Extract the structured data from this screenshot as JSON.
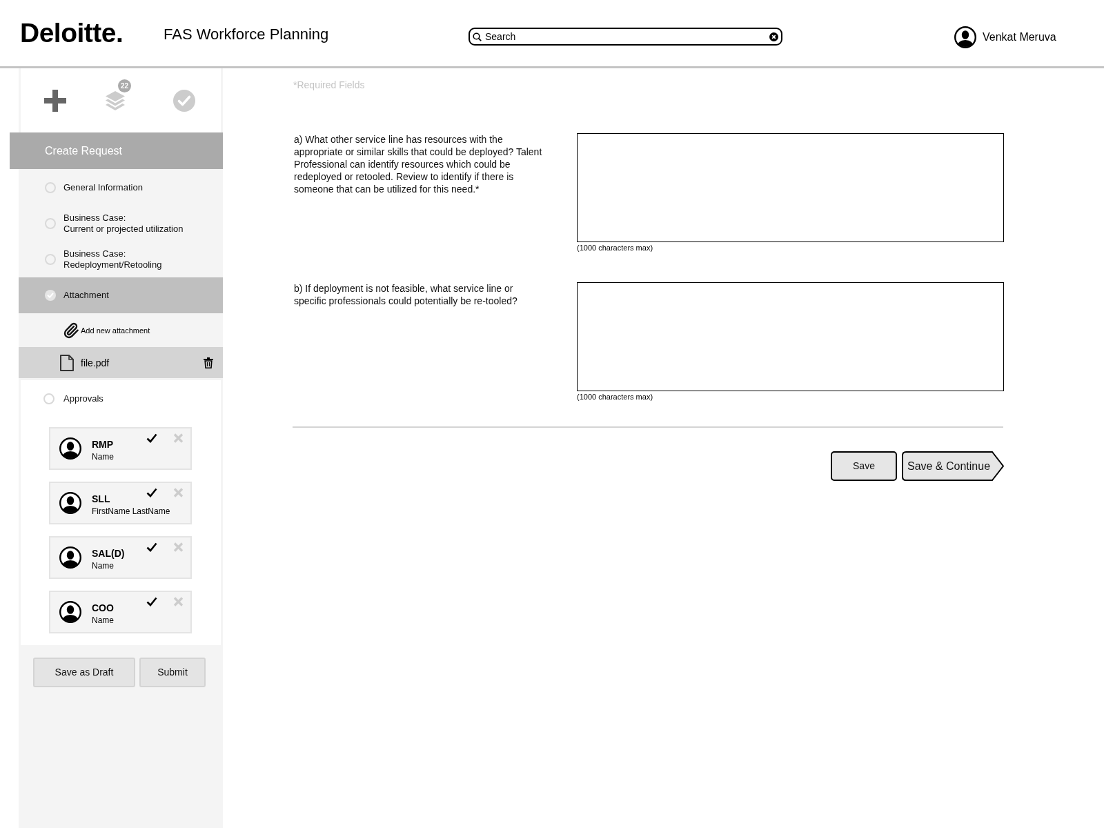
{
  "header": {
    "logo": "Deloitte.",
    "title": "FAS Workforce Planning",
    "search": {
      "placeholder": "Search"
    },
    "user": {
      "name": "Venkat Meruva"
    }
  },
  "sidebar": {
    "toolbar": [
      {
        "kind": "add",
        "active": true
      },
      {
        "kind": "layers",
        "active": false,
        "badge": "22"
      },
      {
        "kind": "done",
        "active": false
      }
    ],
    "section_title": "Create Request",
    "steps": [
      {
        "label": "General Information",
        "checked": false,
        "selected": false
      },
      {
        "label": "Business Case:\nCurrent or projected utilization",
        "checked": false,
        "selected": false
      },
      {
        "label": "Business Case:\nRedeployment/Retooling",
        "checked": false,
        "selected": false
      },
      {
        "label": "Attachment",
        "checked": true,
        "selected": true,
        "add_label": "Add new attachment",
        "files": [
          {
            "name": "file.pdf"
          }
        ]
      },
      {
        "label": "Approvals",
        "checked": false,
        "selected": false,
        "approvers": [
          {
            "role": "RMP",
            "name": "Name"
          },
          {
            "role": "SLL",
            "name": "FirstName LastName"
          },
          {
            "role": "SAL(D)",
            "name": "Name"
          },
          {
            "role": "COO",
            "name": "Name"
          }
        ]
      }
    ],
    "actions": [
      {
        "label": "Save as Draft"
      },
      {
        "label": "Submit"
      }
    ]
  },
  "form": {
    "required_note": "*Required Fields",
    "questions": [
      {
        "label": "a) What other service line has resources with the appropriate or similar skills that could be deployed? Talent Professional can identify resources which could be redeployed or retooled. Review to identify if there is someone that can be utilized for this need.*",
        "hint": "(1000 characters max)"
      },
      {
        "label": "b) If deployment is not feasible, what service line or specific professionals could potentially be re-tooled?",
        "hint": "(1000 characters max)"
      }
    ],
    "buttons": [
      {
        "label": "Save",
        "kind": "plain"
      },
      {
        "label": "Save & Continue",
        "kind": "next"
      }
    ]
  }
}
